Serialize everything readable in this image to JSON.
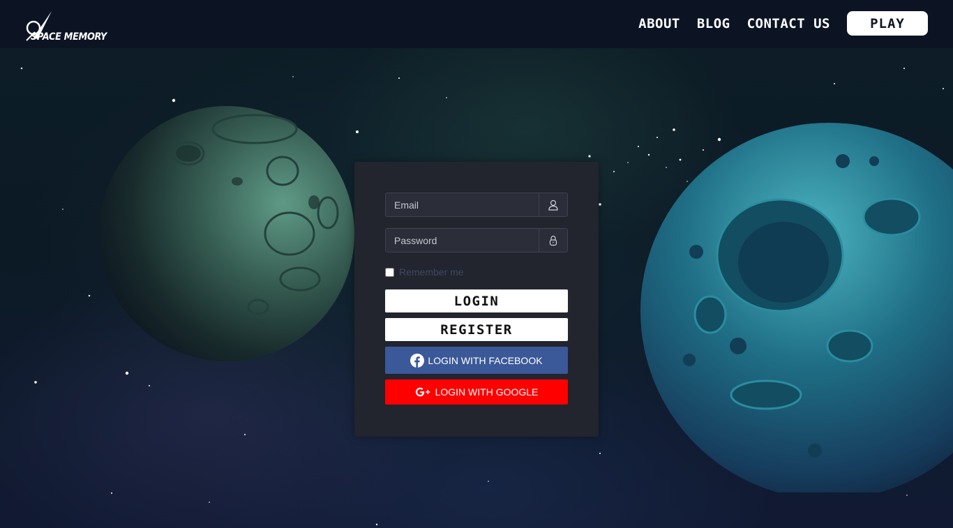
{
  "app": {
    "logo_text": "SPACE MEMORY"
  },
  "nav": {
    "items": [
      {
        "label": "ABOUT"
      },
      {
        "label": "BLOG"
      },
      {
        "label": "CONTACT US"
      }
    ],
    "play_label": "PLAY"
  },
  "login": {
    "email_placeholder": "Email",
    "email_value": "",
    "email_icon": "user-icon",
    "password_placeholder": "Password",
    "password_value": "",
    "password_icon": "lock-icon",
    "remember_label": "Remember me",
    "remember_checked": false,
    "login_label": "LOGIN",
    "register_label": "REGISTER",
    "facebook_label": "LOGIN WITH FACEBOOK",
    "facebook_icon": "facebook-icon",
    "google_label": "LOGIN WITH GOOGLE",
    "google_icon": "google-plus-icon"
  },
  "colors": {
    "panel_bg": "#22242e",
    "facebook": "#3b5998",
    "google": "#ff0000",
    "header_bg": "#0c1424"
  }
}
